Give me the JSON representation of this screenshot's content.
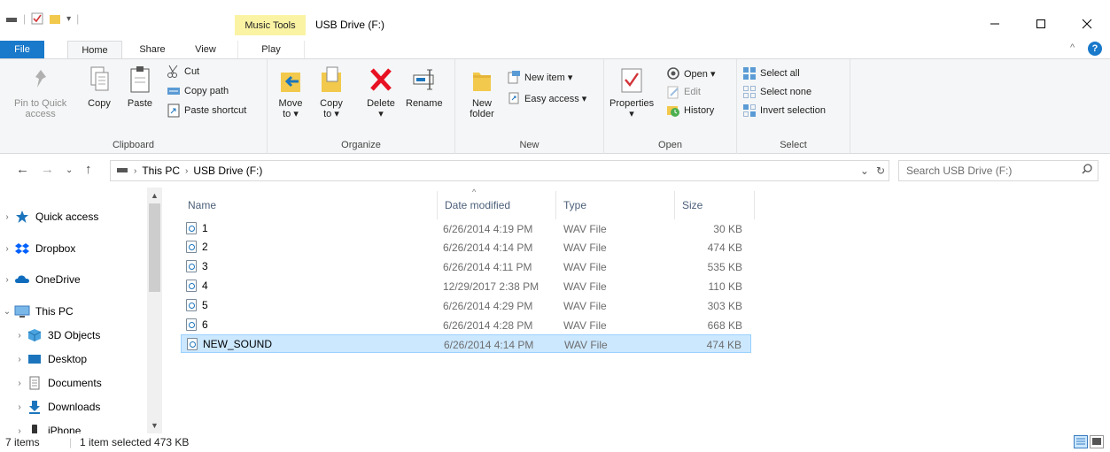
{
  "titlebar": {
    "context_tab": "Music Tools",
    "title": "USB Drive (F:)"
  },
  "tabs": {
    "file": "File",
    "home": "Home",
    "share": "Share",
    "view": "View",
    "play": "Play"
  },
  "ribbon": {
    "clipboard": {
      "label": "Clipboard",
      "pin_line1": "Pin to Quick",
      "pin_line2": "access",
      "copy": "Copy",
      "paste": "Paste",
      "cut": "Cut",
      "copy_path": "Copy path",
      "paste_shortcut": "Paste shortcut"
    },
    "organize": {
      "label": "Organize",
      "move_line1": "Move",
      "move_line2": "to ▾",
      "copy_line1": "Copy",
      "copy_line2": "to ▾",
      "delete": "Delete",
      "delete_arrow": "▾",
      "rename": "Rename"
    },
    "new": {
      "label": "New",
      "new_folder_line1": "New",
      "new_folder_line2": "folder",
      "new_item": "New item ▾",
      "easy_access": "Easy access ▾"
    },
    "open": {
      "label": "Open",
      "properties": "Properties",
      "properties_arrow": "▾",
      "open": "Open ▾",
      "edit": "Edit",
      "history": "History"
    },
    "select": {
      "label": "Select",
      "select_all": "Select all",
      "select_none": "Select none",
      "invert_selection": "Invert selection"
    }
  },
  "address": {
    "this_pc": "This PC",
    "usb_drive": "USB Drive (F:)",
    "search_placeholder": "Search USB Drive (F:)"
  },
  "nav": {
    "items": [
      {
        "label": "Quick access"
      },
      {
        "label": "Dropbox"
      },
      {
        "label": "OneDrive"
      },
      {
        "label": "This PC"
      },
      {
        "label": "3D Objects"
      },
      {
        "label": "Desktop"
      },
      {
        "label": "Documents"
      },
      {
        "label": "Downloads"
      },
      {
        "label": "iPhone"
      }
    ]
  },
  "columns": {
    "name": "Name",
    "date": "Date modified",
    "type": "Type",
    "size": "Size"
  },
  "files": [
    {
      "name": "1",
      "date": "6/26/2014 4:19 PM",
      "type": "WAV File",
      "size": "30 KB"
    },
    {
      "name": "2",
      "date": "6/26/2014 4:14 PM",
      "type": "WAV File",
      "size": "474 KB"
    },
    {
      "name": "3",
      "date": "6/26/2014 4:11 PM",
      "type": "WAV File",
      "size": "535 KB"
    },
    {
      "name": "4",
      "date": "12/29/2017 2:38 PM",
      "type": "WAV File",
      "size": "110 KB"
    },
    {
      "name": "5",
      "date": "6/26/2014 4:29 PM",
      "type": "WAV File",
      "size": "303 KB"
    },
    {
      "name": "6",
      "date": "6/26/2014 4:28 PM",
      "type": "WAV File",
      "size": "668 KB"
    },
    {
      "name": "NEW_SOUND",
      "date": "6/26/2014 4:14 PM",
      "type": "WAV File",
      "size": "474 KB"
    }
  ],
  "status": {
    "count": "7 items",
    "selected": "1 item selected  473 KB"
  },
  "colors": {
    "accent": "#1979ca",
    "selection": "#cce8ff",
    "music_tools": "#faf3a4"
  }
}
